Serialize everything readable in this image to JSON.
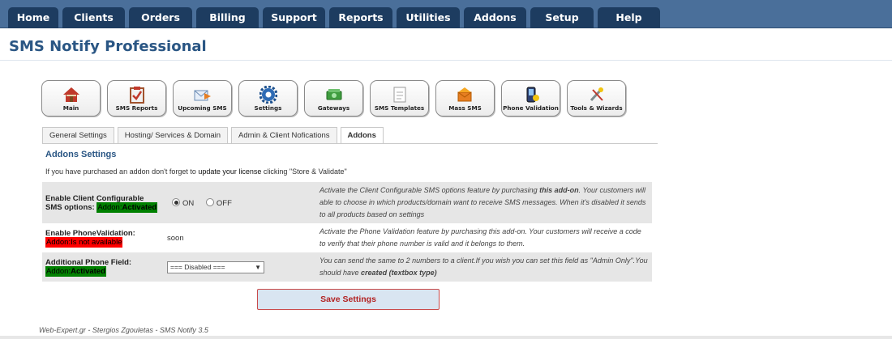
{
  "topnav": [
    "Home",
    "Clients",
    "Orders",
    "Billing",
    "Support",
    "Reports",
    "Utilities",
    "Addons",
    "Setup",
    "Help"
  ],
  "page_title": "SMS Notify Professional",
  "iconmenu": [
    {
      "label": "Main",
      "icon": "house-icon"
    },
    {
      "label": "SMS Reports",
      "icon": "clipboard-icon"
    },
    {
      "label": "Upcoming SMS",
      "icon": "envelope-arrow-icon"
    },
    {
      "label": "Settings",
      "icon": "gear-icon"
    },
    {
      "label": "Gateways",
      "icon": "money-icon"
    },
    {
      "label": "SMS Templates",
      "icon": "template-icon"
    },
    {
      "label": "Mass SMS",
      "icon": "mass-mail-icon"
    },
    {
      "label": "Phone Validation",
      "icon": "phone-icon"
    },
    {
      "label": "Tools & Wizards",
      "icon": "tools-icon"
    }
  ],
  "tabs": [
    "General Settings",
    "Hosting/ Services & Domain",
    "Admin & Client Nofications",
    "Addons"
  ],
  "active_tab": "Addons",
  "section_title": "Addons Settings",
  "info": {
    "pre": "If you have purchased an addon don't forget to ",
    "bold": "update your license",
    "post": " clicking \"Store & Validate\""
  },
  "settings": {
    "row1": {
      "label": "Enable Client Configurable SMS options:",
      "badge_prefix": "Addon:",
      "badge_status": "Activated",
      "radio_on": "ON",
      "radio_off": "OFF",
      "desc_pre": "Activate the Client Configurable SMS options feature by purchasing ",
      "desc_bold": "this add-on",
      "desc_post": ". Your customers will able to choose in which products/domain want to receive SMS messages. When it's disabled it sends to all products based on settings"
    },
    "row2": {
      "label": "Enable PhoneValidation:",
      "badge": "Addon:Is not available",
      "value": "soon",
      "desc": "Activate the Phone Validation feature by purchasing this add-on. Your customers will receive a code to verify that their phone number is valid and it belongs to them."
    },
    "row3": {
      "label": "Additional Phone Field:",
      "badge_prefix": "Addon:",
      "badge_status": "Activated",
      "select_value": "=== Disabled ===",
      "desc_pre": "You can send the same to 2 numbers to a client.If you wish you can set this field as \"Admin Only\".You should have ",
      "desc_bold": "created (textbox type)"
    }
  },
  "save_label": "Save Settings",
  "footer": "Web-Expert.gr - Stergios Zgouletas - SMS Notify 3.5",
  "colors": {
    "nav_bg": "#4a6f9a",
    "nav_tab": "#1d3c60",
    "title": "#2a5684",
    "badge_green": "#008000",
    "badge_red": "#ff0000"
  }
}
